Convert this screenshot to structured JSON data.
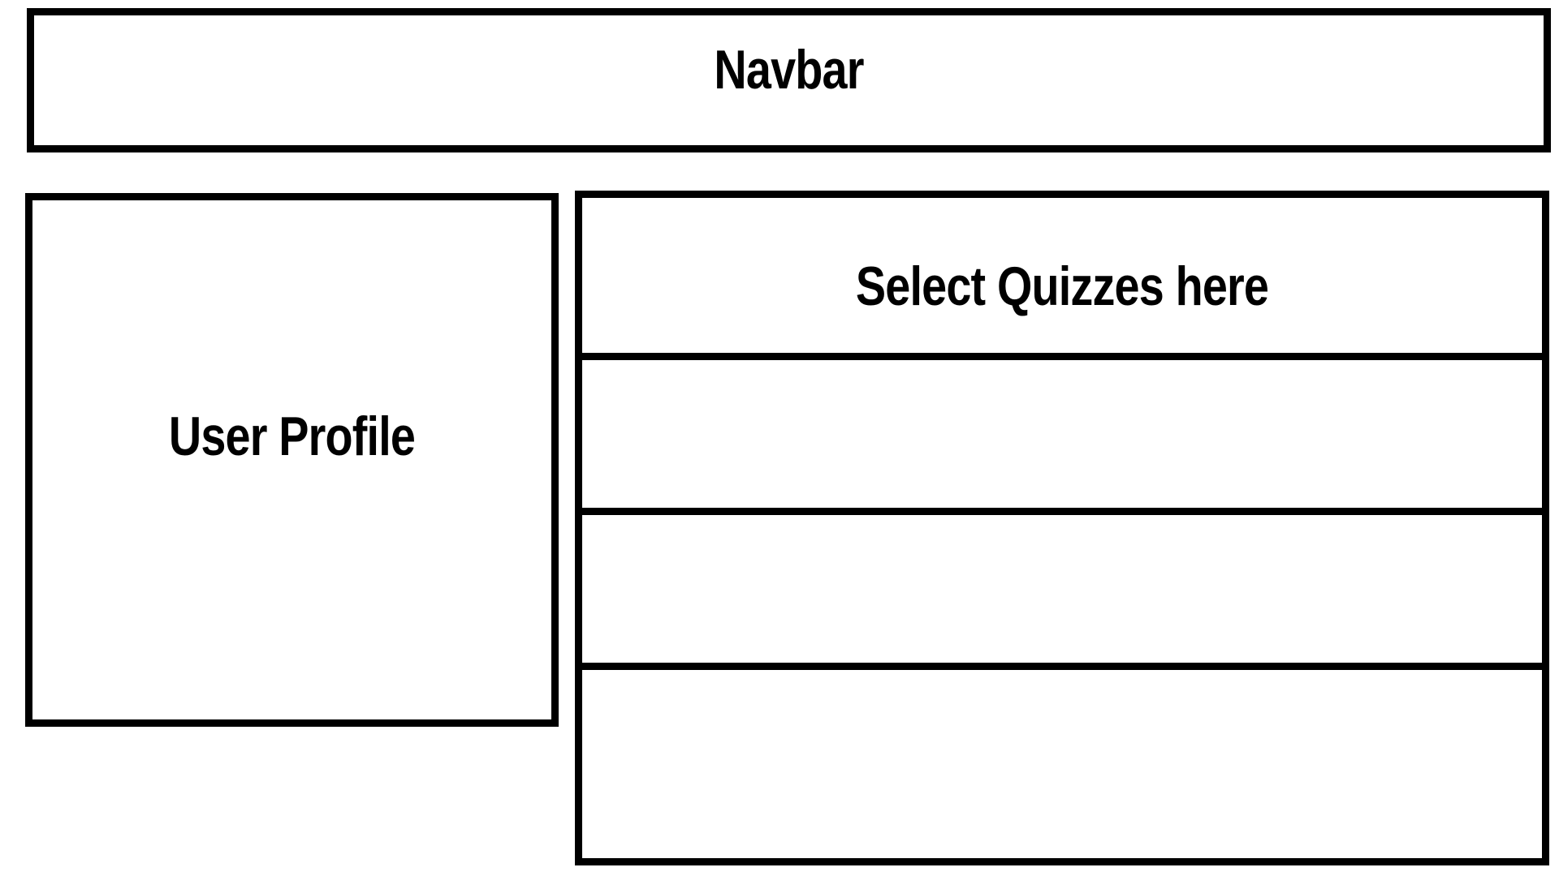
{
  "navbar": {
    "label": "Navbar"
  },
  "user_profile": {
    "label": "User Profile"
  },
  "quiz_panel": {
    "header_label": "Select Quizzes here",
    "rows": [
      "",
      "",
      ""
    ]
  }
}
